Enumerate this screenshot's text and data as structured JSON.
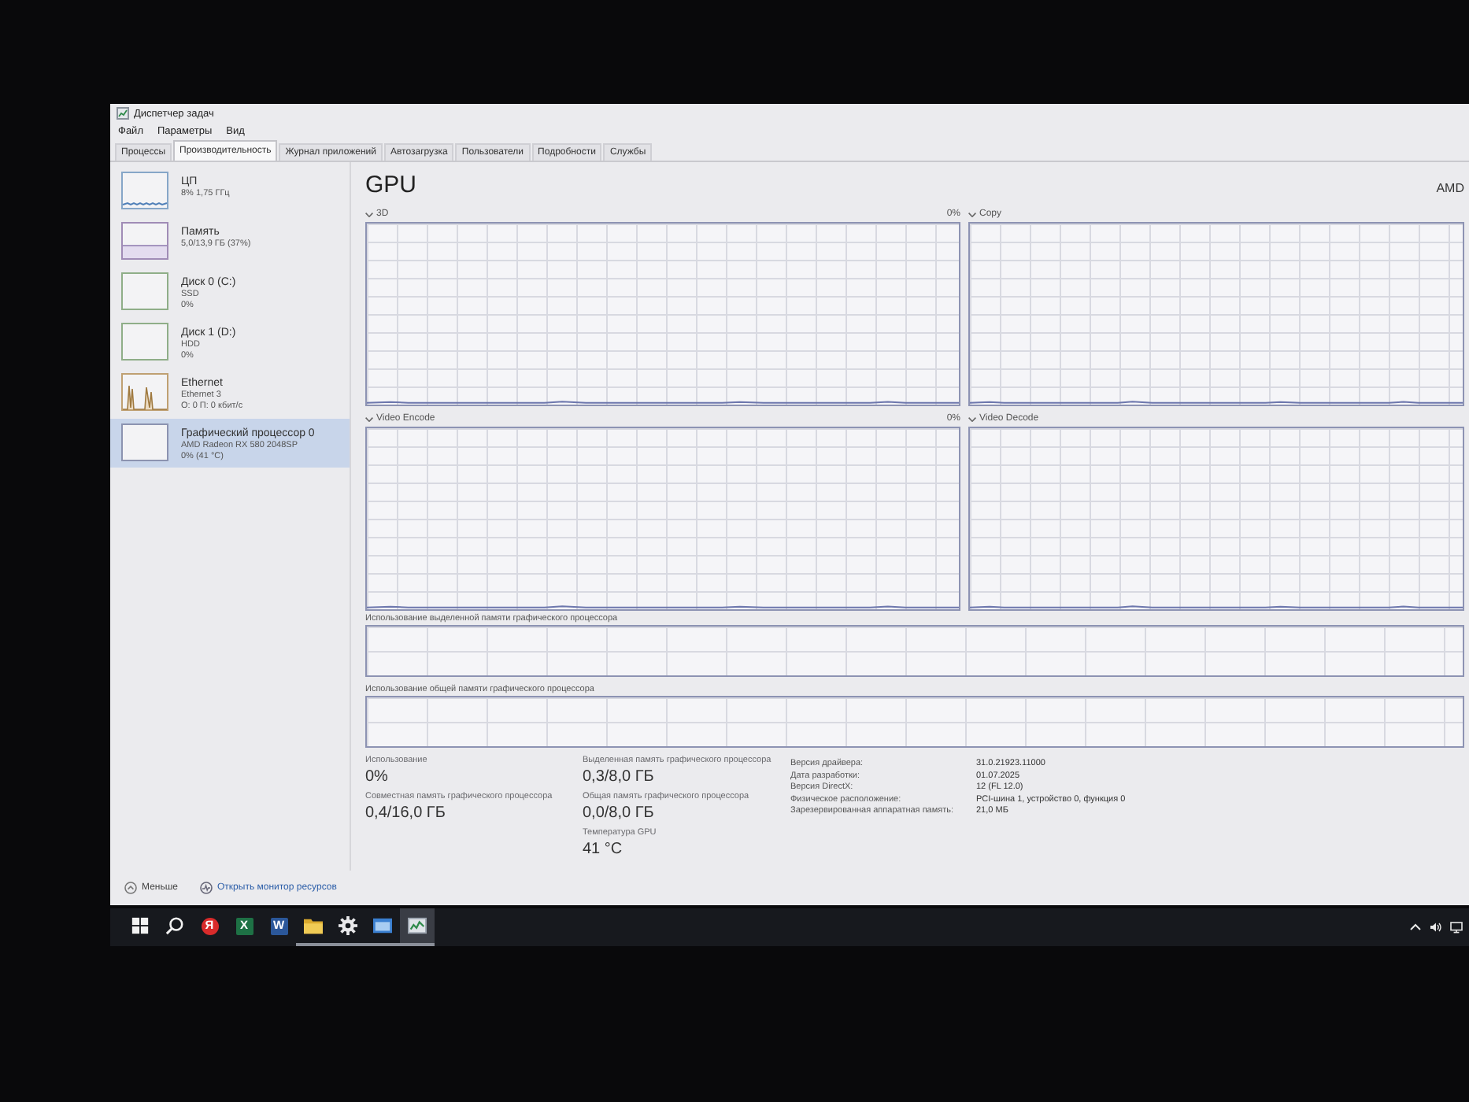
{
  "window": {
    "title": "Диспетчер задач"
  },
  "menu": [
    "Файл",
    "Параметры",
    "Вид"
  ],
  "tabs": [
    {
      "label": "Процессы",
      "selected": false
    },
    {
      "label": "Производительность",
      "selected": true
    },
    {
      "label": "Журнал приложений",
      "selected": false
    },
    {
      "label": "Автозагрузка",
      "selected": false
    },
    {
      "label": "Пользователи",
      "selected": false
    },
    {
      "label": "Подробности",
      "selected": false
    },
    {
      "label": "Службы",
      "selected": false
    }
  ],
  "sidebar": {
    "items": [
      {
        "kind": "cpu",
        "title": "ЦП",
        "details": [
          "8% 1,75 ГГц"
        ],
        "selected": false
      },
      {
        "kind": "memory",
        "title": "Память",
        "details": [
          "5,0/13,9 ГБ (37%)"
        ],
        "selected": false
      },
      {
        "kind": "disk",
        "title": "Диск 0 (C:)",
        "details": [
          "SSD",
          "0%"
        ],
        "selected": false
      },
      {
        "kind": "disk",
        "title": "Диск 1 (D:)",
        "details": [
          "HDD",
          "0%"
        ],
        "selected": false
      },
      {
        "kind": "network",
        "title": "Ethernet",
        "details": [
          "Ethernet 3",
          "О: 0 П: 0 кбит/с"
        ],
        "selected": false
      },
      {
        "kind": "gpu",
        "title": "Графический процессор 0",
        "details": [
          "AMD Radeon RX 580 2048SP",
          "0% (41 °C)"
        ],
        "selected": true
      }
    ]
  },
  "gpu": {
    "title": "GPU",
    "model": "AMD",
    "engines": [
      {
        "label": "3D",
        "reading": "0%"
      },
      {
        "label": "Copy"
      },
      {
        "label": "Video Encode",
        "reading": "0%"
      },
      {
        "label": "Video Decode"
      }
    ],
    "memory_graphs": [
      {
        "label": "Использование выделенной памяти графического процессора"
      },
      {
        "label": "Использование общей памяти графического процессора"
      }
    ],
    "stat_columns": [
      [
        {
          "label": "Использование",
          "value": "0%"
        },
        {
          "label": "Совместная память графического процессора",
          "value": "0,4/16,0 ГБ"
        }
      ],
      [
        {
          "label": "Выделенная память графического процессора",
          "value": "0,3/8,0 ГБ"
        },
        {
          "label": "Общая память графического процессора",
          "value": "0,0/8,0 ГБ"
        },
        {
          "label": "Температура GPU",
          "value": "41 °C"
        }
      ]
    ],
    "properties": [
      {
        "label": "Версия драйвера:",
        "value": "31.0.21923.11000"
      },
      {
        "label": "Дата разработки:",
        "value": "01.07.2025"
      },
      {
        "label": "Версия DirectX:",
        "value": "12 (FL 12.0)"
      },
      {
        "label": "Физическое расположение:",
        "value": "PCI-шина 1, устройство 0, функция 0"
      },
      {
        "label": "Зарезервированная аппаратная память:",
        "value": "21,0 МБ"
      }
    ]
  },
  "footer": {
    "fewer_details": "Меньше",
    "resource_monitor": "Открыть монитор ресурсов"
  },
  "taskbar": {
    "apps": [
      {
        "kind": "browser",
        "glyph": "Я",
        "running": false,
        "selected": false
      },
      {
        "kind": "spreadsheet",
        "glyph": "X",
        "running": false,
        "selected": false
      },
      {
        "kind": "document",
        "glyph": "W",
        "running": false,
        "selected": false
      },
      {
        "kind": "folder",
        "running": true,
        "selected": false
      },
      {
        "kind": "settings",
        "running": true,
        "selected": false
      },
      {
        "kind": "window",
        "running": true,
        "selected": false
      },
      {
        "kind": "taskmanager",
        "running": true,
        "selected": true
      }
    ]
  }
}
